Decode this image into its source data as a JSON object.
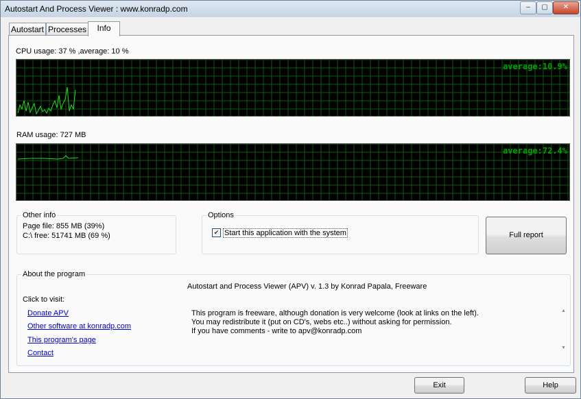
{
  "window": {
    "title": "Autostart And Process Viewer : www.konradp.com"
  },
  "caption_buttons": {
    "minimize": "‒",
    "maximize": "▢",
    "close": "✕"
  },
  "tabs": [
    {
      "label": "Autostart"
    },
    {
      "label": "Processes"
    },
    {
      "label": "Info"
    }
  ],
  "cpu": {
    "label": "CPU usage: 37 % ,average: 10 %",
    "average_text": "average:10.9%"
  },
  "ram": {
    "label": "RAM usage: 727 MB",
    "average_text": "average:72.4%"
  },
  "other_info": {
    "title": "Other info",
    "page_file": "Page file: 855 MB (39%)",
    "disk_free": "C:\\ free: 51741 MB (69 %)"
  },
  "options": {
    "title": "Options",
    "start_with_system": {
      "label": "Start this application with the system",
      "checked": true
    }
  },
  "full_report_label": "Full report",
  "about": {
    "title": "About the program",
    "heading": "Autostart and Process Viewer (APV) v. 1.3  by Konrad Papala, Freeware",
    "click_to_visit": "Click to visit:",
    "links": [
      "Donate APV",
      "Other software at konradp.com",
      "This program's page",
      "Contact"
    ],
    "text_lines": [
      "This program is freeware, although donation is very welcome (look at links on the left).",
      "You may redistribute it (put on CD's, webs etc..) without asking for permission.",
      "If you have comments - write to apv@konradp.com"
    ]
  },
  "buttons": {
    "exit": "Exit",
    "help": "Help"
  },
  "colors": {
    "graph_bg": "#000000",
    "graph_grid": "#0b5a0b",
    "graph_line": "#22dd22",
    "avg_text": "#00a000"
  },
  "icons": {
    "scroll_up": "▲",
    "scroll_down": "▼",
    "check": "✔"
  }
}
